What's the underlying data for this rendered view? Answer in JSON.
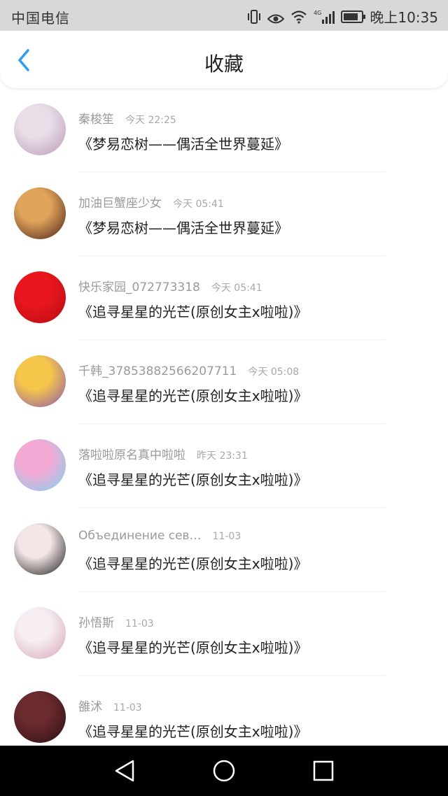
{
  "status_bar": {
    "carrier": "中国电信",
    "network": "4G",
    "time": "晚上10:35",
    "battery_level": 0.85
  },
  "header": {
    "title": "收藏"
  },
  "items": [
    {
      "user": "秦梭笙",
      "time": "今天 22:25",
      "title": "《梦易恋树——偶活全世界蔓延》",
      "avatar_colors": [
        "#e9dde8",
        "#b79bb5"
      ]
    },
    {
      "user": "加油巨蟹座少女",
      "time": "今天 05:41",
      "title": "《梦易恋树——偶活全世界蔓延》",
      "avatar_colors": [
        "#e0a45a",
        "#4a1e18"
      ]
    },
    {
      "user": "快乐家园_072773318",
      "time": "今天 05:41",
      "title": "《追寻星星的光芒(原创女主x啦啦)》",
      "avatar_colors": [
        "#e8161e",
        "#b80c12"
      ]
    },
    {
      "user": "千韩_37853882566207711",
      "time": "今天 05:08",
      "title": "《追寻星星的光芒(原创女主x啦啦)》",
      "avatar_colors": [
        "#f6c64a",
        "#8b58b0"
      ]
    },
    {
      "user": "落啦啦原名真中啦啦",
      "time": "昨天 23:31",
      "title": "《追寻星星的光芒(原创女主x啦啦)》",
      "avatar_colors": [
        "#f3a9d4",
        "#7fd3ef"
      ]
    },
    {
      "user": "Объединение сев…",
      "time": "11-03",
      "title": "《追寻星星的光芒(原创女主x啦啦)》",
      "avatar_colors": [
        "#f4e6e6",
        "#1a1a1a"
      ]
    },
    {
      "user": "孙悟斯",
      "time": "11-03",
      "title": "《追寻星星的光芒(原创女主x啦啦)》",
      "avatar_colors": [
        "#f6eef2",
        "#d7a4b8"
      ]
    },
    {
      "user": "雒沭",
      "time": "11-03",
      "title": "《追寻星星的光芒(原创女主x啦啦)》",
      "avatar_colors": [
        "#6a2a2e",
        "#2a0f12"
      ]
    }
  ],
  "colors": {
    "accent": "#2a9df4"
  }
}
